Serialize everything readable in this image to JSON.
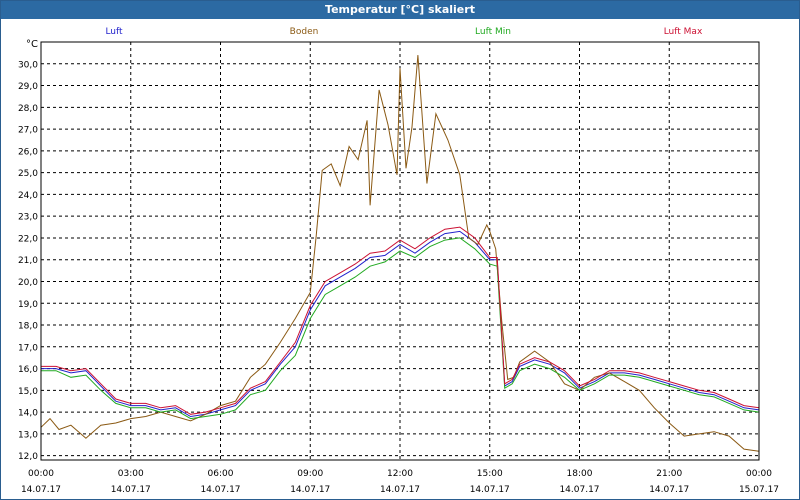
{
  "window": {
    "title": "Temperatur [°C] skaliert"
  },
  "chart_data": {
    "type": "line",
    "title": "Temperatur [°C] skaliert",
    "ylabel": "°C",
    "xlabel": "",
    "ylim": [
      11.8,
      31.0
    ],
    "xlim": [
      0,
      24
    ],
    "grid": true,
    "legend_placement": "top",
    "y_ticks": [
      12.0,
      13.0,
      14.0,
      15.0,
      16.0,
      17.0,
      18.0,
      19.0,
      20.0,
      21.0,
      22.0,
      23.0,
      24.0,
      25.0,
      26.0,
      27.0,
      28.0,
      29.0,
      30.0
    ],
    "y_tick_labels": [
      "12,0",
      "13,0",
      "14,0",
      "15,0",
      "16,0",
      "17,0",
      "18,0",
      "19,0",
      "20,0",
      "21,0",
      "22,0",
      "23,0",
      "24,0",
      "25,0",
      "26,0",
      "27,0",
      "28,0",
      "29,0",
      "30,0"
    ],
    "x_ticks": [
      {
        "x": 0,
        "time": "00:00",
        "date": "14.07.17"
      },
      {
        "x": 3,
        "time": "03:00",
        "date": "14.07.17"
      },
      {
        "x": 6,
        "time": "06:00",
        "date": "14.07.17"
      },
      {
        "x": 9,
        "time": "09:00",
        "date": "14.07.17"
      },
      {
        "x": 12,
        "time": "12:00",
        "date": "14.07.17"
      },
      {
        "x": 15,
        "time": "15:00",
        "date": "14.07.17"
      },
      {
        "x": 18,
        "time": "18:00",
        "date": "14.07.17"
      },
      {
        "x": 21,
        "time": "21:00",
        "date": "14.07.17"
      },
      {
        "x": 24,
        "time": "00:00",
        "date": "15.07.17"
      }
    ],
    "series": [
      {
        "name": "Luft",
        "color": "#2222cc",
        "x": [
          0,
          0.5,
          1,
          1.5,
          2,
          2.5,
          3,
          3.5,
          4,
          4.5,
          5,
          5.5,
          6,
          6.5,
          7,
          7.5,
          8,
          8.5,
          9,
          9.5,
          10,
          10.5,
          11,
          11.5,
          12,
          12.5,
          13,
          13.5,
          14,
          14.5,
          15,
          15.25,
          15.5,
          15.75,
          16,
          16.5,
          17,
          17.5,
          18,
          18.5,
          19,
          19.5,
          20,
          20.5,
          21,
          21.5,
          22,
          22.5,
          23,
          23.5,
          24
        ],
        "y": [
          16.0,
          16.0,
          15.8,
          15.9,
          15.2,
          14.5,
          14.3,
          14.3,
          14.1,
          14.2,
          13.8,
          13.9,
          14.1,
          14.3,
          15.0,
          15.3,
          16.2,
          17.0,
          18.7,
          19.8,
          20.2,
          20.6,
          21.1,
          21.2,
          21.7,
          21.3,
          21.8,
          22.2,
          22.3,
          21.8,
          21.0,
          21.0,
          15.2,
          15.4,
          16.1,
          16.4,
          16.2,
          15.8,
          15.1,
          15.4,
          15.8,
          15.8,
          15.7,
          15.5,
          15.3,
          15.1,
          14.9,
          14.8,
          14.5,
          14.2,
          14.1
        ]
      },
      {
        "name": "Boden",
        "color": "#8b5a14",
        "x": [
          0,
          0.3,
          0.6,
          1,
          1.5,
          2,
          2.5,
          3,
          3.5,
          4,
          4.5,
          5,
          5.5,
          6,
          6.5,
          7,
          7.5,
          8,
          8.5,
          9,
          9.2,
          9.4,
          9.7,
          10,
          10.3,
          10.6,
          10.9,
          11,
          11.3,
          11.6,
          11.9,
          12,
          12.2,
          12.4,
          12.6,
          12.9,
          13.2,
          13.6,
          14,
          14.3,
          14.6,
          14.9,
          15,
          15.2,
          15.4,
          15.6,
          15.8,
          16,
          16.5,
          17,
          17.5,
          18,
          18.5,
          19,
          19.5,
          20,
          20.5,
          21,
          21.5,
          22,
          22.5,
          23,
          23.5,
          24
        ],
        "y": [
          13.3,
          13.7,
          13.2,
          13.4,
          12.8,
          13.4,
          13.5,
          13.7,
          13.8,
          14.0,
          13.8,
          13.6,
          13.9,
          14.3,
          14.5,
          15.6,
          16.2,
          17.2,
          18.3,
          19.5,
          22.1,
          25.1,
          25.4,
          24.4,
          26.2,
          25.6,
          27.4,
          23.5,
          28.8,
          27.2,
          24.9,
          29.8,
          25.2,
          27.1,
          30.4,
          24.5,
          27.7,
          26.5,
          24.9,
          22.0,
          21.7,
          22.6,
          22.3,
          21.5,
          18.2,
          15.5,
          15.6,
          16.3,
          16.8,
          16.3,
          15.3,
          15.0,
          15.6,
          15.8,
          15.4,
          15.0,
          14.2,
          13.5,
          12.9,
          13.0,
          13.1,
          12.9,
          12.3,
          12.2
        ]
      },
      {
        "name": "Luft Min",
        "color": "#22aa22",
        "x": [
          0,
          0.5,
          1,
          1.5,
          2,
          2.5,
          3,
          3.5,
          4,
          4.5,
          5,
          5.5,
          6,
          6.5,
          7,
          7.5,
          8,
          8.5,
          9,
          9.5,
          10,
          10.5,
          11,
          11.5,
          12,
          12.5,
          13,
          13.5,
          14,
          14.5,
          15,
          15.25,
          15.5,
          15.75,
          16,
          16.5,
          17,
          17.5,
          18,
          18.5,
          19,
          19.5,
          20,
          20.5,
          21,
          21.5,
          22,
          22.5,
          23,
          23.5,
          24
        ],
        "y": [
          15.9,
          15.9,
          15.6,
          15.7,
          15.0,
          14.4,
          14.2,
          14.2,
          14.0,
          14.1,
          13.7,
          13.8,
          13.9,
          14.1,
          14.8,
          15.0,
          15.9,
          16.6,
          18.3,
          19.4,
          19.8,
          20.2,
          20.7,
          20.9,
          21.4,
          21.1,
          21.6,
          21.9,
          22.0,
          21.5,
          20.8,
          20.7,
          15.1,
          15.3,
          15.9,
          16.2,
          16.0,
          15.6,
          15.0,
          15.3,
          15.7,
          15.7,
          15.6,
          15.4,
          15.2,
          15.0,
          14.8,
          14.7,
          14.4,
          14.1,
          14.0
        ]
      },
      {
        "name": "Luft Max",
        "color": "#cc1133",
        "x": [
          0,
          0.5,
          1,
          1.5,
          2,
          2.5,
          3,
          3.5,
          4,
          4.5,
          5,
          5.5,
          6,
          6.5,
          7,
          7.5,
          8,
          8.5,
          9,
          9.5,
          10,
          10.5,
          11,
          11.5,
          12,
          12.5,
          13,
          13.5,
          14,
          14.5,
          15,
          15.25,
          15.5,
          15.75,
          16,
          16.5,
          17,
          17.5,
          18,
          18.5,
          19,
          19.5,
          20,
          20.5,
          21,
          21.5,
          22,
          22.5,
          23,
          23.5,
          24
        ],
        "y": [
          16.1,
          16.1,
          15.9,
          16.0,
          15.3,
          14.6,
          14.4,
          14.4,
          14.2,
          14.3,
          13.9,
          14.0,
          14.2,
          14.4,
          15.1,
          15.4,
          16.3,
          17.2,
          18.9,
          20.0,
          20.4,
          20.8,
          21.3,
          21.4,
          21.9,
          21.5,
          22.0,
          22.4,
          22.5,
          22.0,
          21.1,
          21.1,
          15.3,
          15.5,
          16.2,
          16.5,
          16.3,
          15.9,
          15.2,
          15.5,
          15.9,
          15.9,
          15.8,
          15.6,
          15.4,
          15.2,
          15.0,
          14.9,
          14.6,
          14.3,
          14.2
        ]
      }
    ]
  }
}
